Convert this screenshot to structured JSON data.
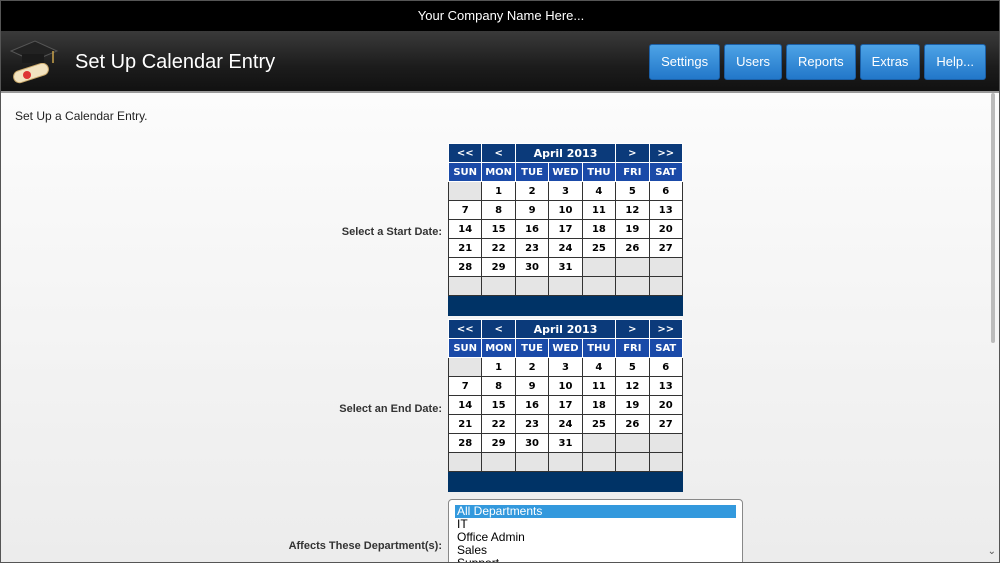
{
  "company_name": "Your Company Name Here...",
  "page_title": "Set Up Calendar Entry",
  "nav": {
    "settings": "Settings",
    "users": "Users",
    "reports": "Reports",
    "extras": "Extras",
    "help": "Help..."
  },
  "intro_text": "Set Up a Calendar Entry.",
  "start_date": {
    "label": "Select a Start Date:",
    "prev_year": "<<",
    "prev_month": "<",
    "month": "April 2013",
    "next_month": ">",
    "next_year": ">>",
    "weekdays": [
      "SUN",
      "MON",
      "TUE",
      "WED",
      "THU",
      "FRI",
      "SAT"
    ],
    "weeks": [
      [
        "",
        "1",
        "2",
        "3",
        "4",
        "5",
        "6"
      ],
      [
        "7",
        "8",
        "9",
        "10",
        "11",
        "12",
        "13"
      ],
      [
        "14",
        "15",
        "16",
        "17",
        "18",
        "19",
        "20"
      ],
      [
        "21",
        "22",
        "23",
        "24",
        "25",
        "26",
        "27"
      ],
      [
        "28",
        "29",
        "30",
        "31",
        "",
        "",
        ""
      ],
      [
        "",
        "",
        "",
        "",
        "",
        "",
        ""
      ]
    ]
  },
  "end_date": {
    "label": "Select an End Date:",
    "prev_year": "<<",
    "prev_month": "<",
    "month": "April 2013",
    "next_month": ">",
    "next_year": ">>",
    "weekdays": [
      "SUN",
      "MON",
      "TUE",
      "WED",
      "THU",
      "FRI",
      "SAT"
    ],
    "weeks": [
      [
        "",
        "1",
        "2",
        "3",
        "4",
        "5",
        "6"
      ],
      [
        "7",
        "8",
        "9",
        "10",
        "11",
        "12",
        "13"
      ],
      [
        "14",
        "15",
        "16",
        "17",
        "18",
        "19",
        "20"
      ],
      [
        "21",
        "22",
        "23",
        "24",
        "25",
        "26",
        "27"
      ],
      [
        "28",
        "29",
        "30",
        "31",
        "",
        "",
        ""
      ],
      [
        "",
        "",
        "",
        "",
        "",
        "",
        ""
      ]
    ]
  },
  "departments": {
    "label": "Affects These Department(s):",
    "options": [
      "All Departments",
      "IT",
      "Office Admin",
      "Sales",
      "Support"
    ],
    "selected": "All Departments"
  },
  "icons": {
    "logo": "graduation-cap-diploma-icon"
  },
  "colors": {
    "nav_button": "#2a85d6",
    "calendar_header": "#0b3a7a",
    "calendar_weekday": "#1a4aa8",
    "calendar_footer": "#003366"
  }
}
